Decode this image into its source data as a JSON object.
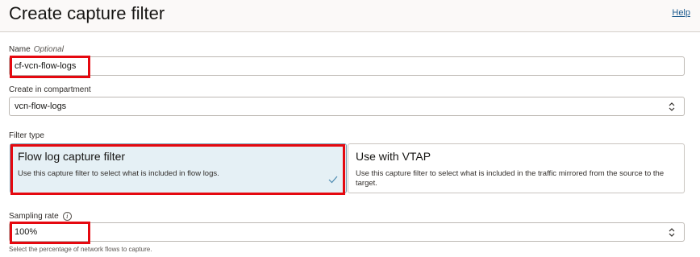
{
  "header": {
    "title": "Create capture filter",
    "help_label": "Help"
  },
  "name_field": {
    "label": "Name",
    "optional_label": "Optional",
    "value": "cf-vcn-flow-logs"
  },
  "compartment": {
    "label": "Create in compartment",
    "value": "vcn-flow-logs"
  },
  "filter_type": {
    "label": "Filter type",
    "options": [
      {
        "title": "Flow log capture filter",
        "description": "Use this capture filter to select what is included in flow logs.",
        "selected": true
      },
      {
        "title": "Use with VTAP",
        "description": "Use this capture filter to select what is included in the traffic mirrored from the source to the target.",
        "selected": false
      }
    ]
  },
  "sampling_rate": {
    "label": "Sampling rate",
    "value": "100%",
    "helper": "Select the percentage of network flows to capture."
  },
  "colors": {
    "highlight": "#e5080f",
    "selected_card_bg": "#e5f0f5",
    "link": "#1d5c8f"
  },
  "icons": {
    "select": "chevron-up-down-icon",
    "check": "checkmark-icon",
    "info": "info-icon"
  }
}
